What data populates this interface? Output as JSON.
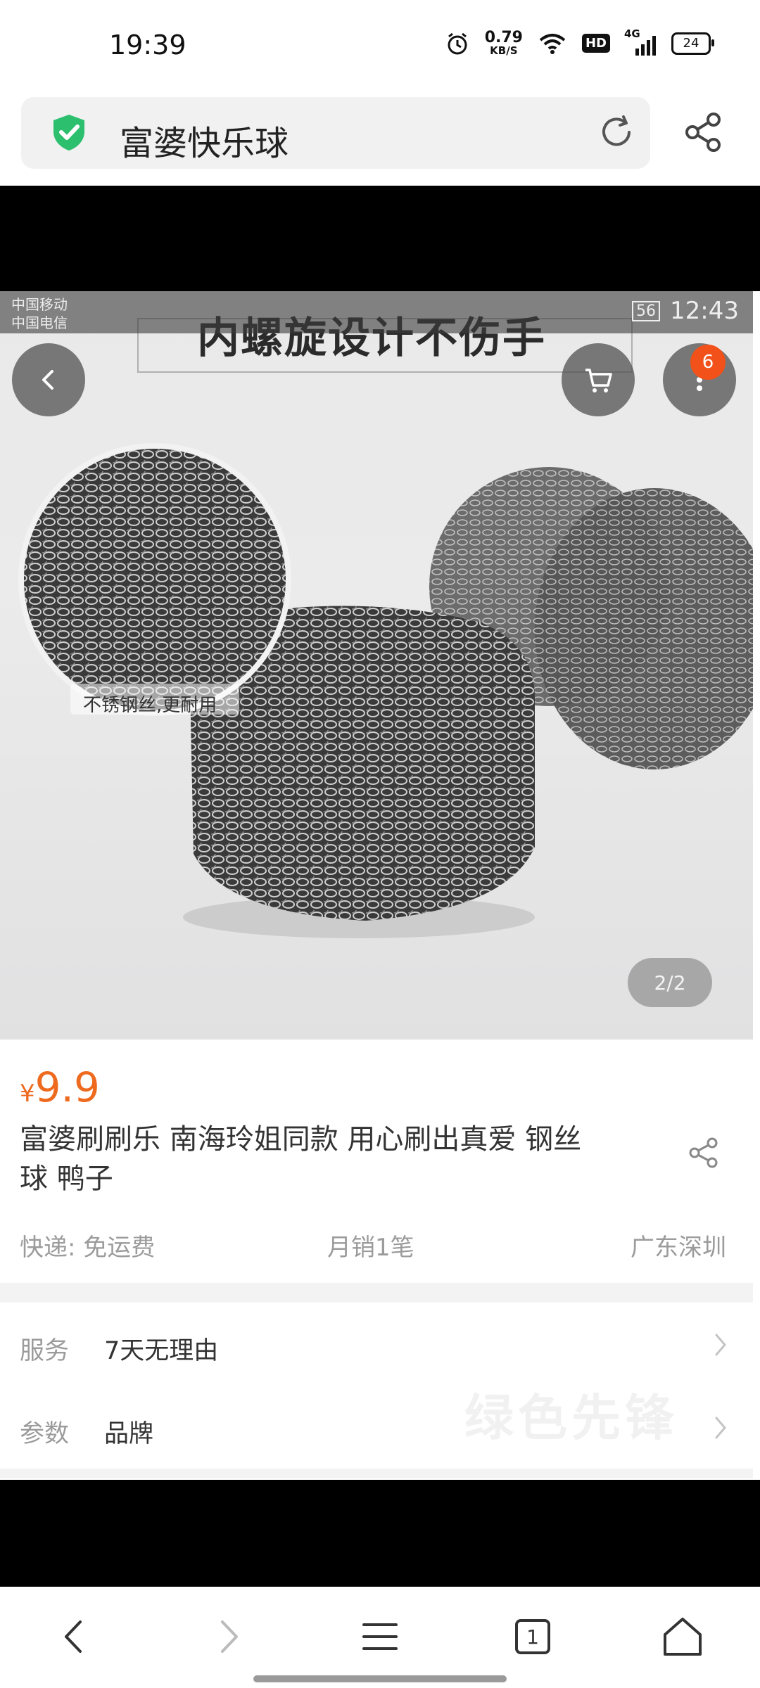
{
  "status_bar": {
    "time": "19:39",
    "speed_value": "0.79",
    "speed_unit": "KB/S",
    "hd": "HD",
    "network": "4G",
    "battery": "24"
  },
  "address_bar": {
    "text": "富婆快乐球"
  },
  "product_image": {
    "inner_status_carrier_1": "中国移动",
    "inner_status_carrier_2": "中国电信",
    "inner_status_battery": "56",
    "inner_status_time": "12:43",
    "headline": "内螺旋设计不伤手",
    "zoom_label": "不锈钢丝,更耐用",
    "cart_badge": "6",
    "page_indicator": "2/2"
  },
  "product": {
    "price_symbol": "¥",
    "price": "9.9",
    "title": "富婆刷刷乐 南海玲姐同款 用心刷出真爱 钢丝球 鸭子",
    "shipping": "快递: 免运费",
    "monthly_sales": "月销1笔",
    "location": "广东深圳"
  },
  "details": {
    "service_label": "服务",
    "service_value": "7天无理由",
    "params_label": "参数",
    "params_value": "品牌"
  },
  "bottom_nav": {
    "tab_count": "1"
  },
  "colors": {
    "price": "#ee6a1f",
    "badge": "#f2511a",
    "shield": "#2bbf6e"
  }
}
